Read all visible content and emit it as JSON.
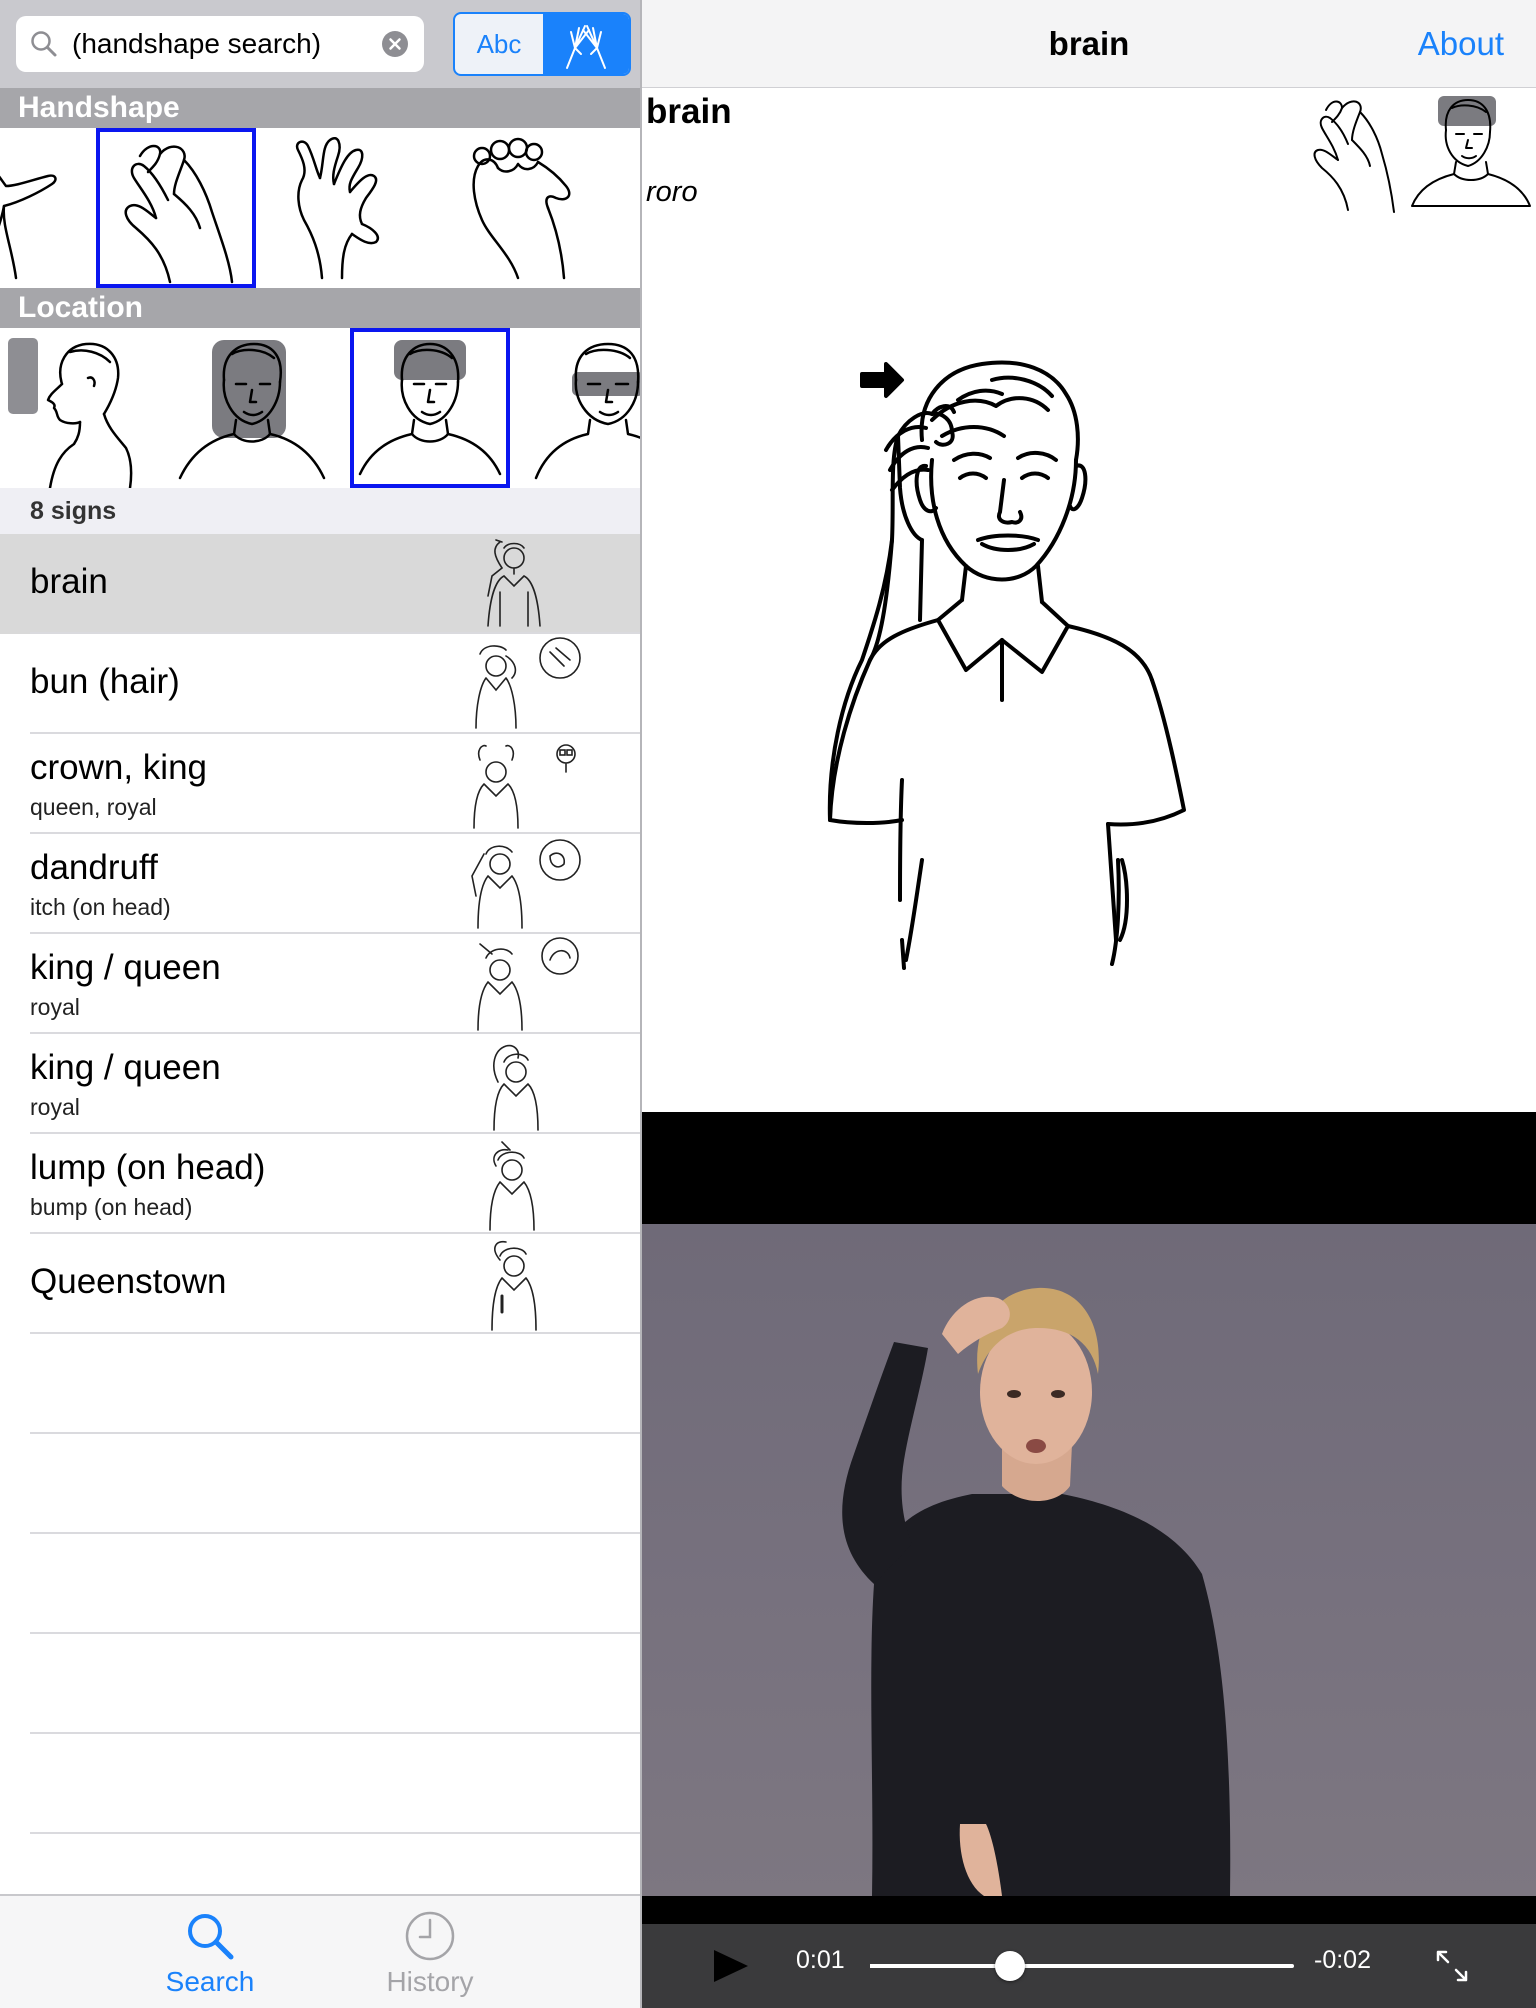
{
  "search": {
    "query": "(handshape search)",
    "abc_label": "Abc"
  },
  "handshape_section": {
    "title": "Handshape"
  },
  "location_section": {
    "title": "Location"
  },
  "results": {
    "count_label": "8 signs",
    "selected_index": 0,
    "items": [
      {
        "title": "brain",
        "subtitle": ""
      },
      {
        "title": "bun (hair)",
        "subtitle": ""
      },
      {
        "title": "crown, king",
        "subtitle": "queen, royal"
      },
      {
        "title": "dandruff",
        "subtitle": "itch (on head)"
      },
      {
        "title": "king / queen",
        "subtitle": "royal"
      },
      {
        "title": "king / queen",
        "subtitle": "royal"
      },
      {
        "title": "lump (on head)",
        "subtitle": "bump (on head)"
      },
      {
        "title": "Queenstown",
        "subtitle": ""
      }
    ]
  },
  "tabs": {
    "search_label": "Search",
    "history_label": "History",
    "active": "search"
  },
  "detail": {
    "nav_title": "brain",
    "about_label": "About",
    "word": "brain",
    "maori": "roro"
  },
  "video": {
    "elapsed": "0:01",
    "remaining": "-0:02",
    "progress": 0.33
  },
  "colors": {
    "accent": "#1a82fb",
    "selection_border": "#0a16f0",
    "section_header": "#a6a6aa",
    "selected_row": "#d9d9d9"
  }
}
